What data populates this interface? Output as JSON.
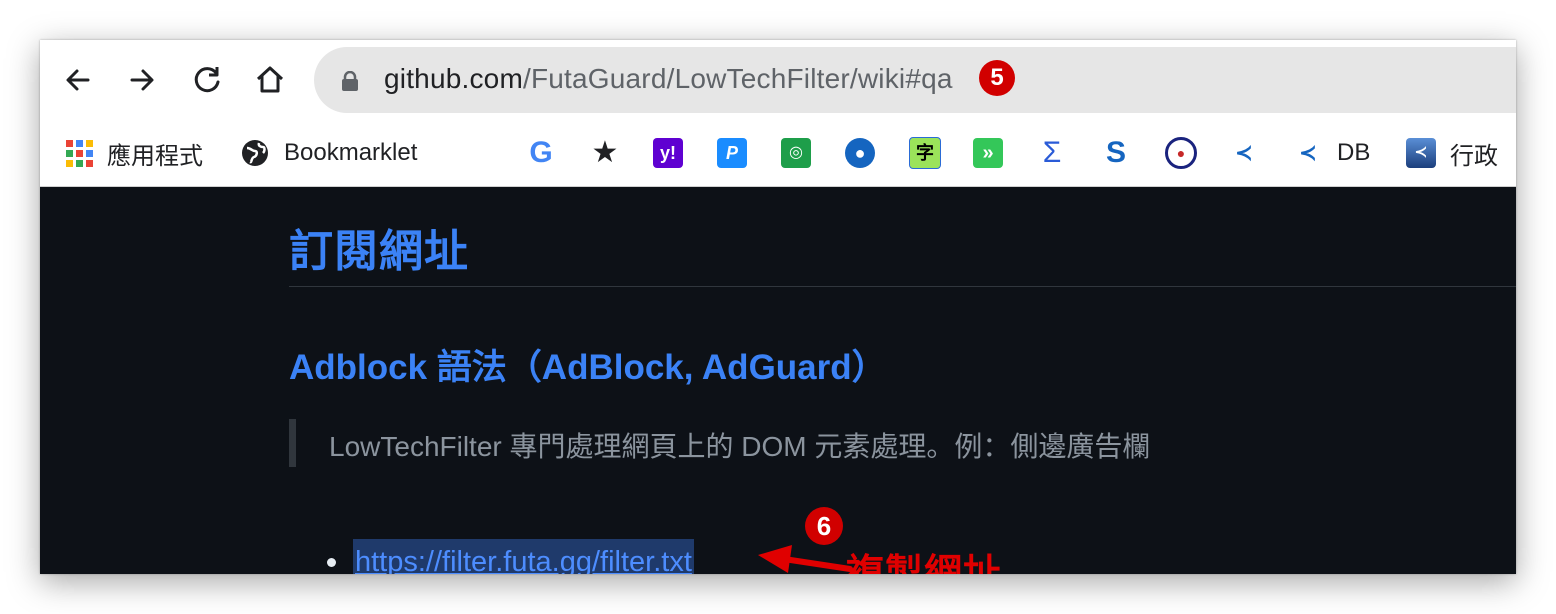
{
  "browser": {
    "url_host": "github.com",
    "url_path": "/FutaGuard/LowTechFilter/wiki#qa",
    "step_badge_url": "5"
  },
  "bookmarks": [
    {
      "label": "應用程式",
      "icon": "apps-grid-icon"
    },
    {
      "label": "Bookmarklet",
      "icon": "globe-icon"
    },
    {
      "label": "",
      "icon": "google-icon"
    },
    {
      "label": "",
      "icon": "star-icon"
    },
    {
      "label": "",
      "icon": "yahoo-icon"
    },
    {
      "label": "",
      "icon": "p-icon"
    },
    {
      "label": "",
      "icon": "green-app-icon"
    },
    {
      "label": "",
      "icon": "eye-icon"
    },
    {
      "label": "",
      "icon": "dictionary-icon"
    },
    {
      "label": "",
      "icon": "forward-green-icon"
    },
    {
      "label": "",
      "icon": "sigma-icon"
    },
    {
      "label": "",
      "icon": "s-stripe-icon"
    },
    {
      "label": "",
      "icon": "seal-icon"
    },
    {
      "label": "",
      "icon": "bird-icon"
    },
    {
      "label": "DB",
      "icon": "bird-icon"
    },
    {
      "label": "行政",
      "icon": "blue-square-icon"
    }
  ],
  "content": {
    "heading": "訂閱網址",
    "subheading": "Adblock 語法（AdBlock, AdGuard）",
    "quote": "LowTechFilter 專門處理網頁上的 DOM 元素處理。例：側邊廣告欄",
    "link": "https://filter.futa.gg/filter.txt",
    "step_badge_link": "6",
    "annotation": "複製網址"
  },
  "colors": {
    "heading": "#3b82f6",
    "page_bg": "#0d1117",
    "annotation": "#e00000"
  }
}
